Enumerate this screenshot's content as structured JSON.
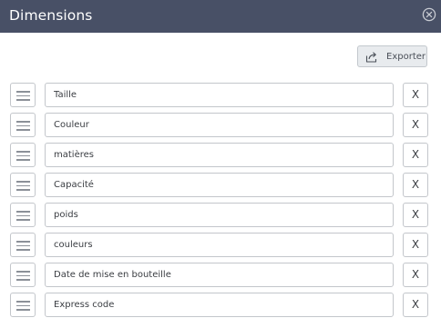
{
  "dialog": {
    "title": "Dimensions",
    "close_icon": "close-circle-icon"
  },
  "toolbar": {
    "export_label": "Exporter",
    "export_icon": "share-export-icon"
  },
  "rows": [
    {
      "value": "Taille",
      "remove_label": "X"
    },
    {
      "value": "Couleur",
      "remove_label": "X"
    },
    {
      "value": "matières",
      "remove_label": "X"
    },
    {
      "value": "Capacité",
      "remove_label": "X"
    },
    {
      "value": "poids",
      "remove_label": "X"
    },
    {
      "value": "couleurs",
      "remove_label": "X"
    },
    {
      "value": "Date de mise en bouteille",
      "remove_label": "X"
    },
    {
      "value": "Express code",
      "remove_label": "X"
    }
  ],
  "colors": {
    "header_bg": "#485066",
    "border": "#c3c6cb",
    "export_bg": "#e8ebee"
  }
}
